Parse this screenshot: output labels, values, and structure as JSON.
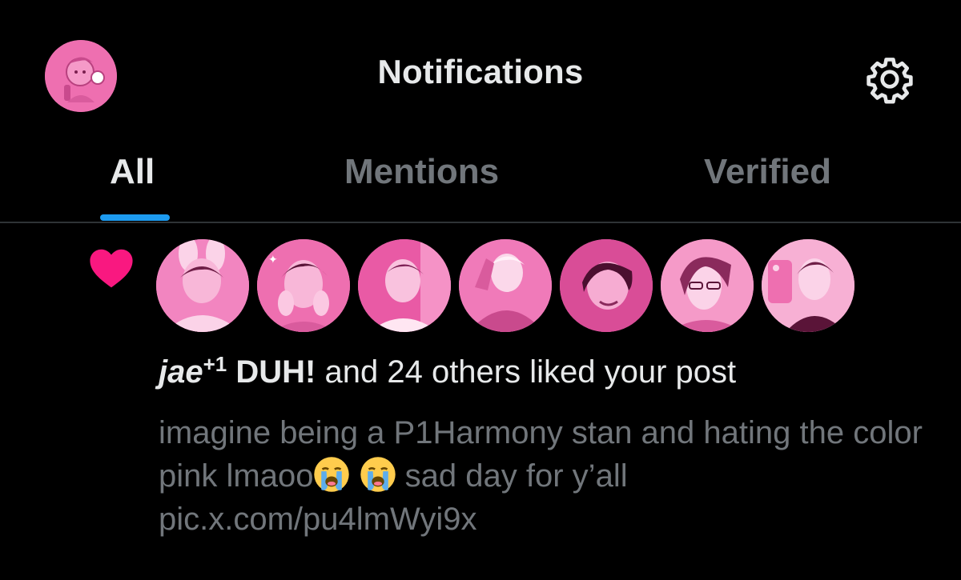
{
  "header": {
    "title": "Notifications",
    "avatar_icon": "profile-avatar-pink-cartoon",
    "settings_icon": "gear-icon"
  },
  "tabs": [
    {
      "label": "All",
      "active": true
    },
    {
      "label": "Mentions",
      "active": false
    },
    {
      "label": "Verified",
      "active": false
    }
  ],
  "notification": {
    "type_icon": "heart-icon",
    "type_color": "#f91880",
    "liker_avatar_count": 7,
    "user1": "jae",
    "user1_suffix": "+1",
    "user2": "DUH!",
    "action_text": " and 24 others liked your post",
    "post_text_line1": "imagine being a P1Harmony stan and hating the color pink lmaoo",
    "post_text_line2": " sad day for y’all",
    "post_link": "pic.x.com/pu4lmWyi9x",
    "emoji": "loudly-crying-face"
  },
  "colors": {
    "background": "#000000",
    "primary_text": "#e7e9ea",
    "secondary_text": "#71767b",
    "accent": "#1d9bf0",
    "like": "#f91880",
    "avatar_pink": "#f07ab9",
    "divider": "#2f3336"
  }
}
